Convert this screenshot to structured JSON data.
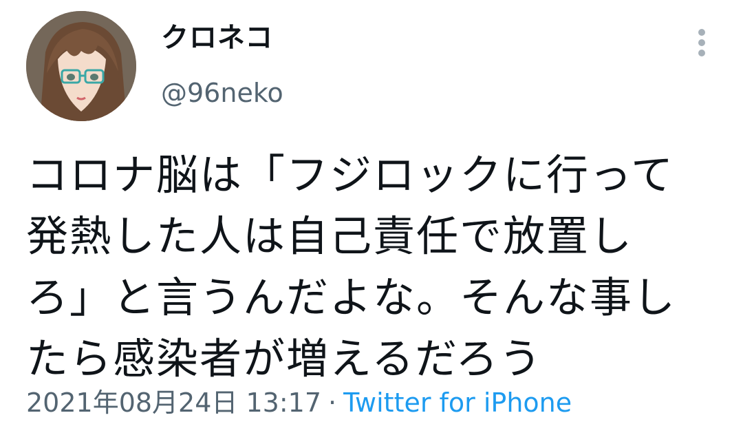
{
  "user": {
    "display_name": "クロネコ",
    "username": "@96neko",
    "avatar_icon": "user-avatar"
  },
  "menu": {
    "more_icon": "more-vertical-icon"
  },
  "tweet": {
    "lines": [
      "コロナ脳は「フジロックに行って",
      "発熱した人は自己責任で放置し",
      "ろ」と言うんだよな。そんな事し",
      "たら感染者が増えるだろう"
    ]
  },
  "meta": {
    "timestamp": "2021年08月24日 13:17",
    "separator": "·",
    "source": "Twitter for iPhone"
  },
  "colors": {
    "text": "#0f1419",
    "secondary": "#536471",
    "link": "#1d9bf0"
  }
}
